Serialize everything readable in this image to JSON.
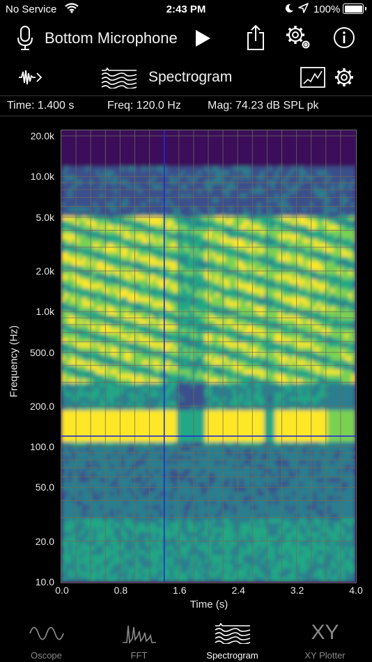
{
  "status": {
    "carrier": "No Service",
    "time": "2:43 PM",
    "battery_pct": "100%"
  },
  "header": {
    "input_source": "Bottom Microphone",
    "view_title": "Spectrogram",
    "icons": [
      "microphone-icon",
      "play-icon",
      "share-icon",
      "settings-gear-icon",
      "info-icon",
      "waveform-menu-icon",
      "spectrogram-icon",
      "chart-icon",
      "settings-gear-icon"
    ]
  },
  "readout": {
    "time": "Time: 1.400 s",
    "freq": "Freq: 120.0 Hz",
    "mag": "Mag: 74.23 dB SPL pk"
  },
  "chart_data": {
    "type": "heatmap",
    "xlabel": "Time (s)",
    "ylabel": "Frequency (Hz)",
    "x_ticks": [
      "0.0",
      "0.8",
      "1.6",
      "2.4",
      "3.2",
      "4.0"
    ],
    "x_tick_values": [
      0.0,
      0.8,
      1.6,
      2.4,
      3.2,
      4.0
    ],
    "y_ticks": [
      "20.0k",
      "10.0k",
      "5.0k",
      "2.0k",
      "1.0k",
      "500.0",
      "200.0",
      "100.0",
      "50.0",
      "20.0",
      "10.0"
    ],
    "y_tick_values": [
      20000,
      10000,
      5000,
      2000,
      1000,
      500,
      200,
      100,
      50,
      20,
      10
    ],
    "xlim": [
      0,
      4.0
    ],
    "ylim": [
      10,
      22000
    ],
    "y_scale": "log",
    "grid": true,
    "cursor": {
      "time": 1.4,
      "freq": 120.0
    },
    "colormap": [
      "#3a0e5a",
      "#3b4f8c",
      "#2c7e8e",
      "#23a884",
      "#7ad151",
      "#fde725"
    ]
  },
  "tabs": [
    {
      "label": "Oscope",
      "icon": "oscilloscope-wave-icon",
      "active": false
    },
    {
      "label": "FFT",
      "icon": "fft-peaks-icon",
      "active": false
    },
    {
      "label": "Spectrogram",
      "icon": "spectrogram-icon",
      "active": true
    },
    {
      "label": "XY Plotter",
      "icon": "xy-icon",
      "active": false
    }
  ],
  "tab_xy_glyph": "XY"
}
